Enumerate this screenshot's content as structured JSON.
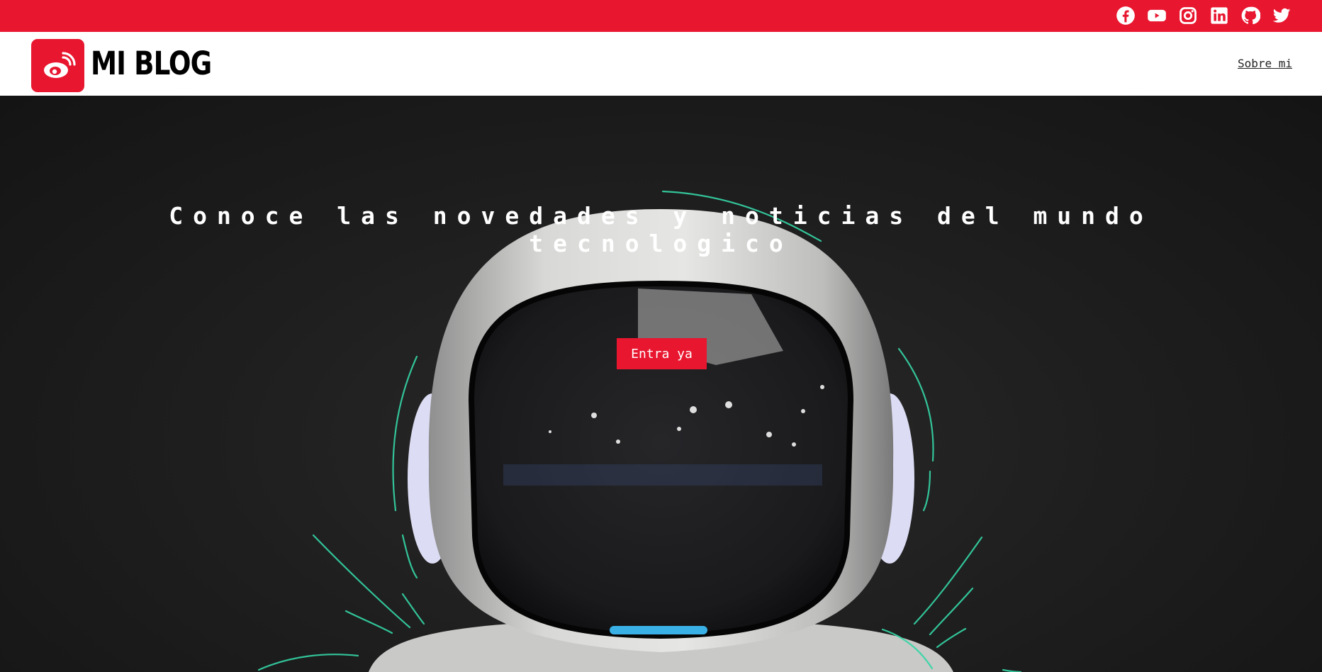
{
  "brand": {
    "name": "MI BLOG",
    "accent_color": "#e8162f"
  },
  "topbar": {
    "social_icons": [
      "facebook-icon",
      "youtube-icon",
      "instagram-icon",
      "linkedin-icon",
      "github-icon",
      "twitter-icon"
    ]
  },
  "nav": {
    "about_label": "Sobre mi"
  },
  "hero": {
    "title": "Conoce las novedades y noticias del mundo tecnologico",
    "cta_label": "Entra ya",
    "image_subject": "robot-helmet-image"
  }
}
